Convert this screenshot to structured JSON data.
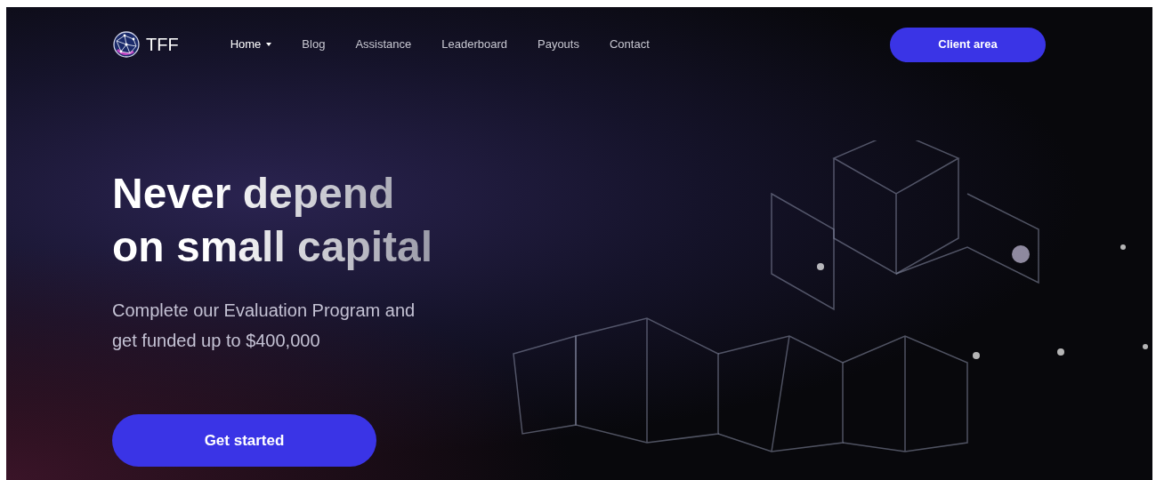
{
  "logo": {
    "text": "TFF"
  },
  "nav": [
    {
      "label": "Home",
      "selected": true,
      "dropdown": true
    },
    {
      "label": "Blog",
      "selected": false,
      "dropdown": false
    },
    {
      "label": "Assistance",
      "selected": false,
      "dropdown": false
    },
    {
      "label": "Leaderboard",
      "selected": false,
      "dropdown": false
    },
    {
      "label": "Payouts",
      "selected": false,
      "dropdown": false
    },
    {
      "label": "Contact",
      "selected": false,
      "dropdown": false
    }
  ],
  "client_button": "Client area",
  "hero": {
    "title_lines": [
      "Never depend",
      "on small capital"
    ],
    "subtitle_lines": [
      "Complete our Evaluation Program and",
      "get funded up to $400,000"
    ],
    "cta": "Get started"
  }
}
